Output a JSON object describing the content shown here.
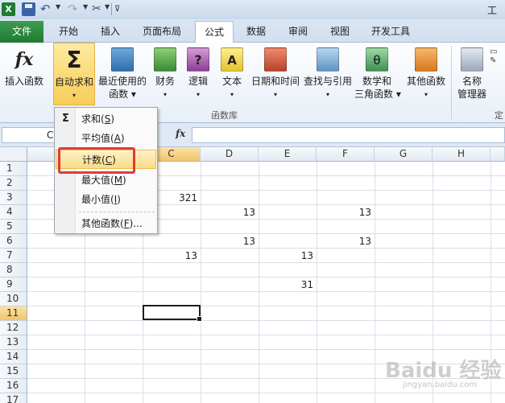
{
  "title_fragment": "工作",
  "tabs": [
    {
      "label": "文件"
    },
    {
      "label": "开始"
    },
    {
      "label": "插入"
    },
    {
      "label": "页面布局"
    },
    {
      "label": "公式"
    },
    {
      "label": "数据"
    },
    {
      "label": "审阅"
    },
    {
      "label": "视图"
    },
    {
      "label": "开发工具"
    }
  ],
  "ribbon": {
    "insert_function": "插入函数",
    "autosum_line1": "自动求和",
    "autosum_arrow": "▾",
    "recent_line1": "最近使用的",
    "recent_line2": "函数 ▾",
    "financial_line1": "财务",
    "logical_line1": "逻辑",
    "text_line1": "文本",
    "datetime_line1": "日期和时间",
    "lookup_line1": "查找与引用",
    "math_line1": "数学和",
    "math_line2": "三角函数 ▾",
    "more_line1": "其他函数",
    "names_line1": "名称",
    "names_line2": "管理器",
    "group_label": "函数库",
    "group_label_2": "定",
    "fx_symbol": "fx",
    "sigma_symbol": "Σ",
    "theta_symbol": "θ",
    "question_symbol": "?",
    "a_symbol": "A"
  },
  "formula_bar": {
    "name_box": "C",
    "fx_label": "fx"
  },
  "columns": [
    "C",
    "D",
    "E",
    "F",
    "G",
    "H"
  ],
  "rows": [
    "1",
    "2",
    "3",
    "4",
    "5",
    "6",
    "7",
    "8",
    "9",
    "10",
    "11",
    "12",
    "13",
    "14",
    "15",
    "16",
    "17"
  ],
  "cells": {
    "c3": "321",
    "d4": "13",
    "f4": "13",
    "d6": "13",
    "f6": "13",
    "c7": "13",
    "e7": "13",
    "e9": "31"
  },
  "menu": {
    "sigma": "Σ",
    "items": [
      {
        "text": "求和(",
        "key": "S",
        "end": ")"
      },
      {
        "text": "平均值(",
        "key": "A",
        "end": ")"
      },
      {
        "text": "计数(",
        "key": "C",
        "end": ")"
      },
      {
        "text": "最大值(",
        "key": "M",
        "end": ")"
      },
      {
        "text": "最小值(",
        "key": "I",
        "end": ")"
      },
      {
        "text": "其他函数(",
        "key": "F",
        "end": ")..."
      }
    ]
  },
  "watermark": "Baidu 经验",
  "watermark_sub": "jingyan.baidu.com"
}
